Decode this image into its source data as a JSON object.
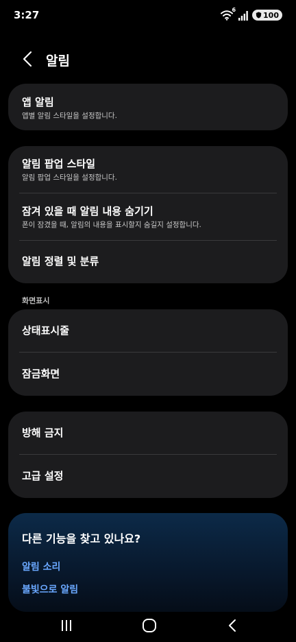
{
  "status_bar": {
    "time": "3:27",
    "wifi_badge": "6",
    "battery_level": "100",
    "icons": [
      "wifi-icon",
      "signal-icon",
      "battery-icon"
    ]
  },
  "header": {
    "title": "알림",
    "back_icon": "chevron-left-icon"
  },
  "card1": {
    "app_notifications": {
      "title": "앱 알림",
      "subtitle": "앱별 알림 스타일을 설정합니다."
    }
  },
  "card2": {
    "popup_style": {
      "title": "알림 팝업 스타일",
      "subtitle": "알림 팝업 스타일을 설정합니다."
    },
    "hide_content": {
      "title": "잠겨 있을 때 알림 내용 숨기기",
      "subtitle": "폰이 잠겼을 때, 알림의 내용을 표시할지 숨길지 설정합니다."
    },
    "sort": {
      "title": "알림 정렬 및 분류"
    }
  },
  "display_section": {
    "label": "화면표시",
    "status_bar_item": "상태표시줄",
    "lock_screen_item": "잠금화면"
  },
  "card4": {
    "dnd": "방해 금지",
    "advanced": "고급 설정"
  },
  "suggestions": {
    "title": "다른 기능을 찾고 있나요?",
    "links": [
      "알림 소리",
      "불빛으로 알림"
    ]
  },
  "colors": {
    "background": "#000000",
    "card": "#1c1c1e",
    "divider": "#3a3a3c",
    "link": "#6aa8ff"
  },
  "nav_bar": {
    "icons": [
      "recents-icon",
      "home-icon",
      "back-icon"
    ]
  }
}
